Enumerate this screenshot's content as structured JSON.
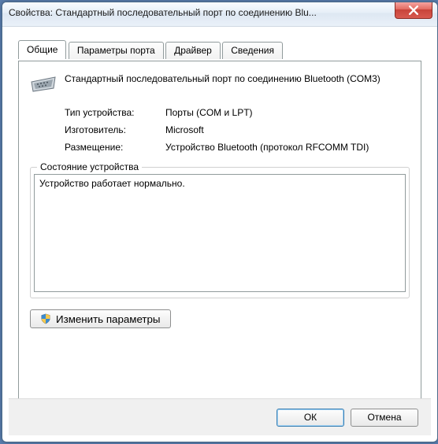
{
  "title": "Свойства: Стандартный последовательный порт по соединению Blu...",
  "tabs": {
    "general": "Общие",
    "port": "Параметры порта",
    "driver": "Драйвер",
    "details": "Сведения"
  },
  "device": {
    "name": "Стандартный последовательный порт по соединению Bluetooth (COM3)",
    "type_label": "Тип устройства:",
    "type_value": "Порты (COM и LPT)",
    "manufacturer_label": "Изготовитель:",
    "manufacturer_value": "Microsoft",
    "location_label": "Размещение:",
    "location_value": "Устройство Bluetooth (протокол RFCOMM TDI)"
  },
  "status": {
    "group_title": "Состояние устройства",
    "text": "Устройство работает нормально."
  },
  "change_settings_label": "Изменить параметры",
  "buttons": {
    "ok": "ОК",
    "cancel": "Отмена"
  }
}
